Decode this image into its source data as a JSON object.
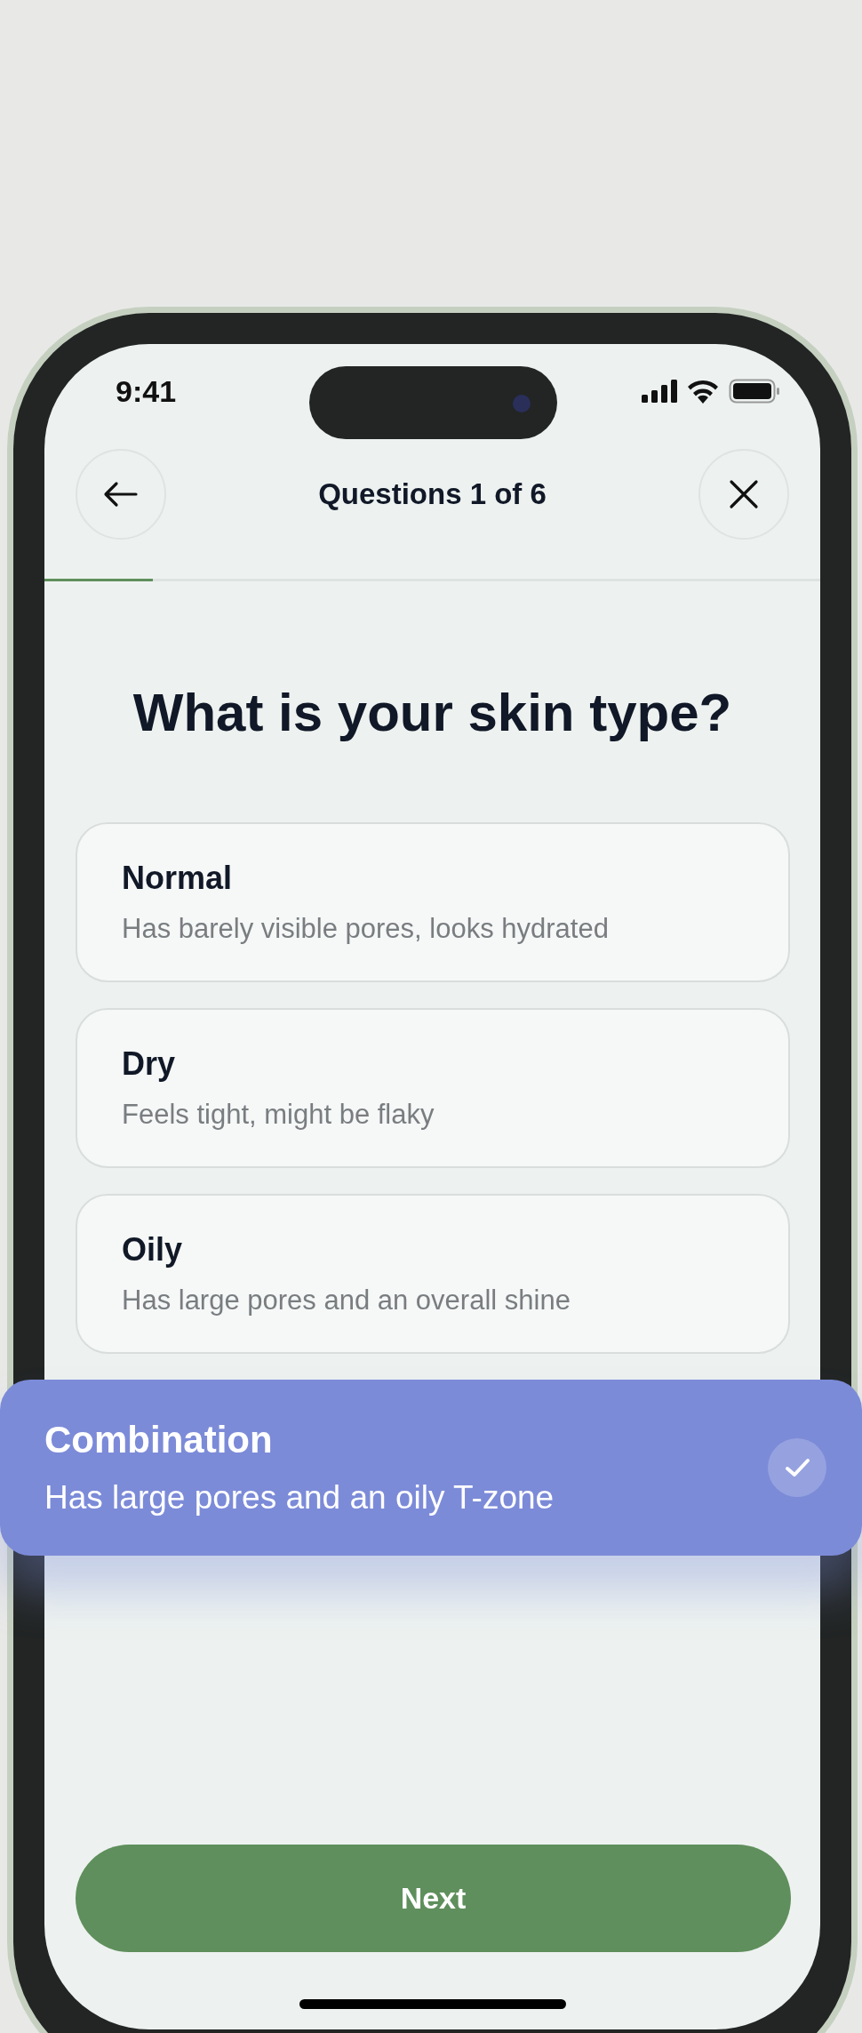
{
  "status_bar": {
    "time": "9:41"
  },
  "header": {
    "title": "Questions 1 of 6"
  },
  "progress": {
    "level": 0.14
  },
  "question": "What is your skin type?",
  "options": [
    {
      "title": "Normal",
      "description": "Has barely visible pores, looks hydrated",
      "selected": false
    },
    {
      "title": "Dry",
      "description": "Feels tight, might be flaky",
      "selected": false
    },
    {
      "title": "Oily",
      "description": "Has large pores and an overall shine",
      "selected": false
    },
    {
      "title": "Combination",
      "description": "Has large pores and an oily T-zone",
      "selected": true
    }
  ],
  "primary_button": "Next"
}
